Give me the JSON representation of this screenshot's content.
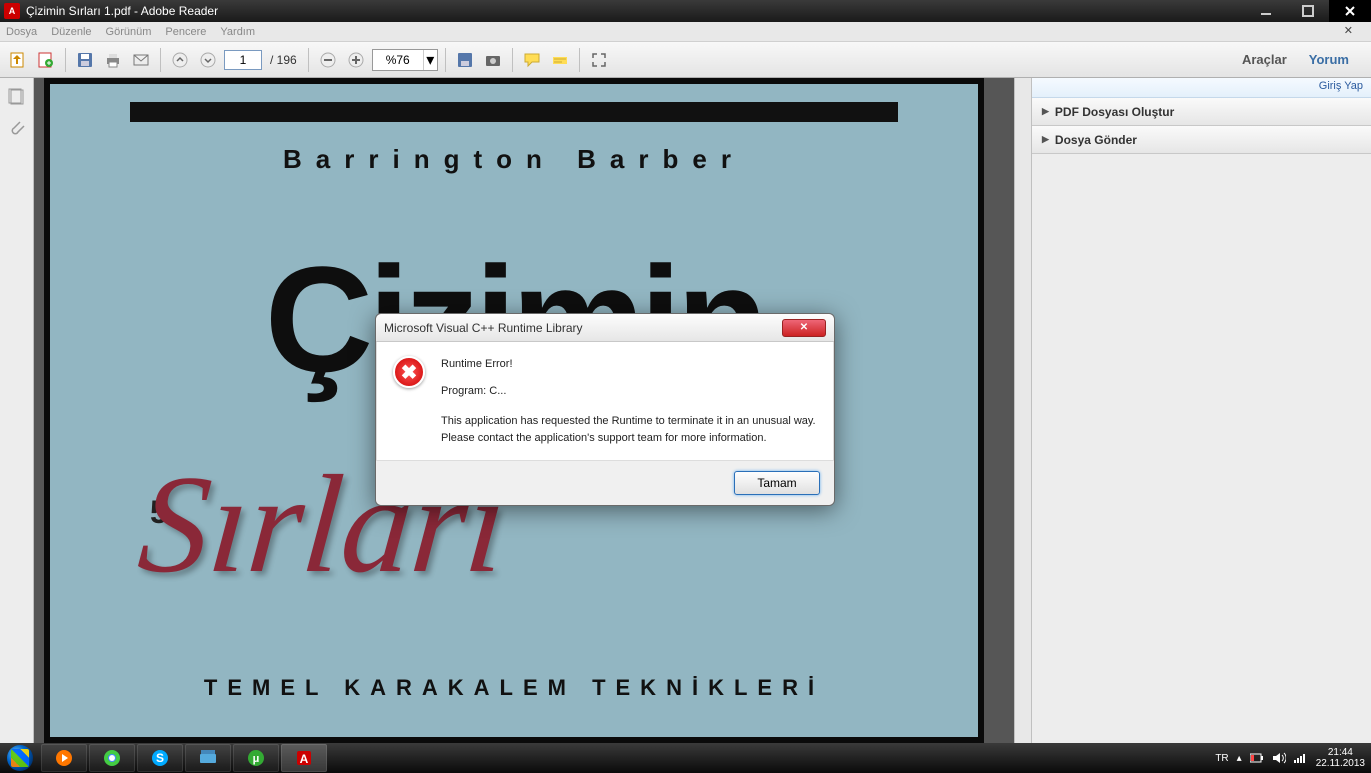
{
  "titlebar": {
    "title": "Çizimin Sırları 1.pdf - Adobe Reader"
  },
  "menu": {
    "items": [
      "Dosya",
      "Düzenle",
      "Görünüm",
      "Pencere",
      "Yardım"
    ]
  },
  "toolbar": {
    "page_current": "1",
    "page_total": "/ 196",
    "zoom": "%76",
    "right": {
      "tools": "Araçlar",
      "comment": "Yorum"
    }
  },
  "sidepanel": {
    "login": "Giriş Yap",
    "items": [
      "PDF Dosyası Oluştur",
      "Dosya Gönder"
    ]
  },
  "document": {
    "author": "Barrington Barber",
    "title_upper": "Çizimin",
    "five": "5",
    "title_script": "Sırları",
    "subtitle": "TEMEL KARAKALEM TEKNİKLERİ"
  },
  "dialog": {
    "title": "Microsoft Visual C++ Runtime Library",
    "heading": "Runtime Error!",
    "program": "Program: C...",
    "body1": "This application has requested the Runtime to terminate it in an unusual way.",
    "body2": "Please contact the application's support team for more information.",
    "ok": "Tamam"
  },
  "tray": {
    "lang": "TR",
    "time": "21:44",
    "date": "22.11.2013"
  }
}
